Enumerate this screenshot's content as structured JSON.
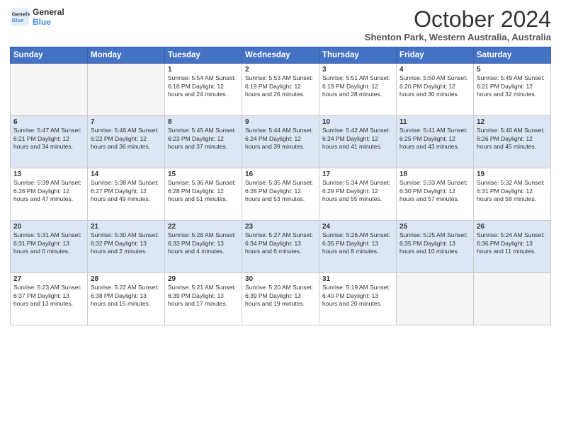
{
  "header": {
    "logo_line1": "General",
    "logo_line2": "Blue",
    "month": "October 2024",
    "location": "Shenton Park, Western Australia, Australia"
  },
  "weekdays": [
    "Sunday",
    "Monday",
    "Tuesday",
    "Wednesday",
    "Thursday",
    "Friday",
    "Saturday"
  ],
  "weeks": [
    [
      {
        "day": "",
        "info": ""
      },
      {
        "day": "",
        "info": ""
      },
      {
        "day": "1",
        "info": "Sunrise: 5:54 AM\nSunset: 6:18 PM\nDaylight: 12 hours and 24 minutes."
      },
      {
        "day": "2",
        "info": "Sunrise: 5:53 AM\nSunset: 6:19 PM\nDaylight: 12 hours and 26 minutes."
      },
      {
        "day": "3",
        "info": "Sunrise: 5:51 AM\nSunset: 6:19 PM\nDaylight: 12 hours and 28 minutes."
      },
      {
        "day": "4",
        "info": "Sunrise: 5:50 AM\nSunset: 6:20 PM\nDaylight: 12 hours and 30 minutes."
      },
      {
        "day": "5",
        "info": "Sunrise: 5:49 AM\nSunset: 6:21 PM\nDaylight: 12 hours and 32 minutes."
      }
    ],
    [
      {
        "day": "6",
        "info": "Sunrise: 5:47 AM\nSunset: 6:21 PM\nDaylight: 12 hours and 34 minutes."
      },
      {
        "day": "7",
        "info": "Sunrise: 5:46 AM\nSunset: 6:22 PM\nDaylight: 12 hours and 36 minutes."
      },
      {
        "day": "8",
        "info": "Sunrise: 5:45 AM\nSunset: 6:23 PM\nDaylight: 12 hours and 37 minutes."
      },
      {
        "day": "9",
        "info": "Sunrise: 5:44 AM\nSunset: 6:24 PM\nDaylight: 12 hours and 39 minutes."
      },
      {
        "day": "10",
        "info": "Sunrise: 5:42 AM\nSunset: 6:24 PM\nDaylight: 12 hours and 41 minutes."
      },
      {
        "day": "11",
        "info": "Sunrise: 5:41 AM\nSunset: 6:25 PM\nDaylight: 12 hours and 43 minutes."
      },
      {
        "day": "12",
        "info": "Sunrise: 5:40 AM\nSunset: 6:26 PM\nDaylight: 12 hours and 45 minutes."
      }
    ],
    [
      {
        "day": "13",
        "info": "Sunrise: 5:39 AM\nSunset: 6:26 PM\nDaylight: 12 hours and 47 minutes."
      },
      {
        "day": "14",
        "info": "Sunrise: 5:38 AM\nSunset: 6:27 PM\nDaylight: 12 hours and 49 minutes."
      },
      {
        "day": "15",
        "info": "Sunrise: 5:36 AM\nSunset: 6:28 PM\nDaylight: 12 hours and 51 minutes."
      },
      {
        "day": "16",
        "info": "Sunrise: 5:35 AM\nSunset: 6:28 PM\nDaylight: 12 hours and 53 minutes."
      },
      {
        "day": "17",
        "info": "Sunrise: 5:34 AM\nSunset: 6:29 PM\nDaylight: 12 hours and 55 minutes."
      },
      {
        "day": "18",
        "info": "Sunrise: 5:33 AM\nSunset: 6:30 PM\nDaylight: 12 hours and 57 minutes."
      },
      {
        "day": "19",
        "info": "Sunrise: 5:32 AM\nSunset: 6:31 PM\nDaylight: 12 hours and 58 minutes."
      }
    ],
    [
      {
        "day": "20",
        "info": "Sunrise: 5:31 AM\nSunset: 6:31 PM\nDaylight: 13 hours and 0 minutes."
      },
      {
        "day": "21",
        "info": "Sunrise: 5:30 AM\nSunset: 6:32 PM\nDaylight: 13 hours and 2 minutes."
      },
      {
        "day": "22",
        "info": "Sunrise: 5:28 AM\nSunset: 6:33 PM\nDaylight: 13 hours and 4 minutes."
      },
      {
        "day": "23",
        "info": "Sunrise: 5:27 AM\nSunset: 6:34 PM\nDaylight: 13 hours and 6 minutes."
      },
      {
        "day": "24",
        "info": "Sunrise: 5:26 AM\nSunset: 6:35 PM\nDaylight: 13 hours and 8 minutes."
      },
      {
        "day": "25",
        "info": "Sunrise: 5:25 AM\nSunset: 6:35 PM\nDaylight: 13 hours and 10 minutes."
      },
      {
        "day": "26",
        "info": "Sunrise: 5:24 AM\nSunset: 6:36 PM\nDaylight: 13 hours and 11 minutes."
      }
    ],
    [
      {
        "day": "27",
        "info": "Sunrise: 5:23 AM\nSunset: 6:37 PM\nDaylight: 13 hours and 13 minutes."
      },
      {
        "day": "28",
        "info": "Sunrise: 5:22 AM\nSunset: 6:38 PM\nDaylight: 13 hours and 15 minutes."
      },
      {
        "day": "29",
        "info": "Sunrise: 5:21 AM\nSunset: 6:39 PM\nDaylight: 13 hours and 17 minutes."
      },
      {
        "day": "30",
        "info": "Sunrise: 5:20 AM\nSunset: 6:39 PM\nDaylight: 13 hours and 19 minutes."
      },
      {
        "day": "31",
        "info": "Sunrise: 5:19 AM\nSunset: 6:40 PM\nDaylight: 13 hours and 20 minutes."
      },
      {
        "day": "",
        "info": ""
      },
      {
        "day": "",
        "info": ""
      }
    ]
  ]
}
